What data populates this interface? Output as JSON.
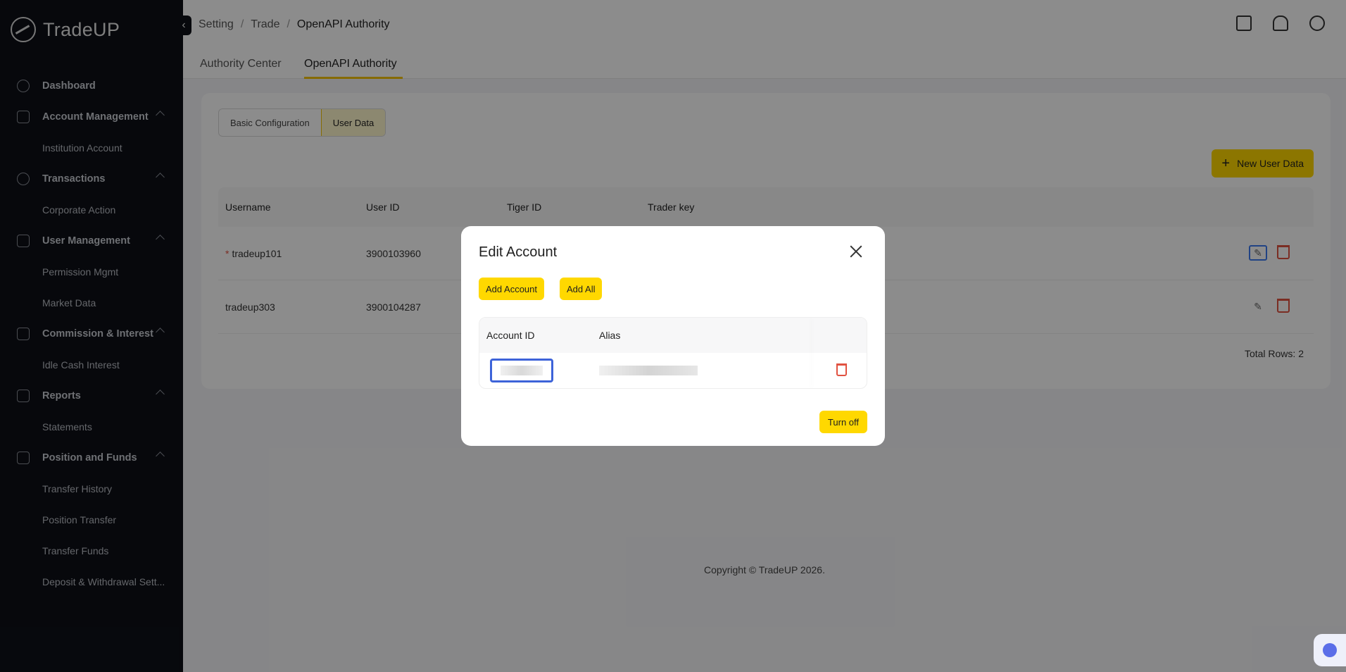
{
  "brand": {
    "name": "TradeUP"
  },
  "sidebar": {
    "groups": [
      {
        "label": "Dashboard",
        "items": []
      },
      {
        "label": "Account Management",
        "items": [
          "Institution Account"
        ]
      },
      {
        "label": "Transactions",
        "items": [
          "Corporate Action"
        ]
      },
      {
        "label": "User Management",
        "items": [
          "Permission Mgmt",
          "Market Data"
        ]
      },
      {
        "label": "Commission & Interest",
        "items": [
          "Idle Cash Interest"
        ]
      },
      {
        "label": "Reports",
        "items": [
          "Statements"
        ]
      },
      {
        "label": "Position and Funds",
        "items": [
          "Transfer History",
          "Position Transfer",
          "Transfer Funds",
          "Deposit & Withdrawal Sett..."
        ]
      }
    ]
  },
  "breadcrumb": [
    "Setting",
    "Trade",
    "OpenAPI Authority"
  ],
  "tabs": {
    "authority_center": "Authority Center",
    "openapi_authority": "OpenAPI Authority"
  },
  "segments": {
    "basic": "Basic Configuration",
    "user_data": "User Data"
  },
  "new_button": "New User Data",
  "table": {
    "headers": [
      "Username",
      "User ID",
      "Tiger ID",
      "Trader key"
    ],
    "rows": [
      {
        "username": "tradeup101",
        "user_id": "3900103960",
        "required": "*"
      },
      {
        "username": "tradeup303",
        "user_id": "3900104287",
        "required": ""
      }
    ],
    "total": "Total Rows: 2"
  },
  "copyright": "Copyright © TradeUP 2026.",
  "modal": {
    "title": "Edit Account",
    "add_account": "Add Account",
    "add_all": "Add All",
    "headers": [
      "Account ID",
      "Alias"
    ],
    "turn_off": "Turn off"
  },
  "colors": {
    "accent": "#ffd800",
    "sidebar_bg": "#0d1017",
    "danger": "#e15241",
    "focus": "#3d63d9"
  }
}
